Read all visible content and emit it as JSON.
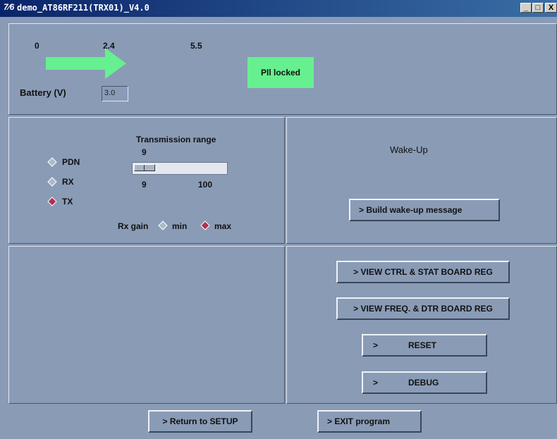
{
  "window": {
    "icon_text": "7⁄6",
    "title": "demo_AT86RF211(TRX01)_V4.0",
    "minimize": "_",
    "maximize": "□",
    "close": "X"
  },
  "battery": {
    "scale_labels": [
      "0",
      "2.4",
      "5.5"
    ],
    "label": "Battery (V)",
    "value": "3.0",
    "indicator_color": "#66f08f"
  },
  "pll_status": "Pll locked",
  "mode": {
    "options": [
      "PDN",
      "RX",
      "TX"
    ],
    "selected": "TX"
  },
  "transmission_range": {
    "title": "Transmission range",
    "current": "9",
    "min": "9",
    "max": "100",
    "level": 0
  },
  "rx_gain": {
    "label": "Rx gain",
    "options": [
      "min",
      "max"
    ],
    "selected": "max"
  },
  "wakeup": {
    "title": "Wake-Up",
    "build_button": ">   Build wake-up message"
  },
  "board_buttons": {
    "view_ctrl": "> VIEW CTRL & STAT BOARD REG",
    "view_freq": "> VIEW FREQ. & DTR BOARD REG",
    "reset_arrow": ">",
    "reset": "RESET",
    "debug_arrow": ">",
    "debug": "DEBUG"
  },
  "footer": {
    "return": "> Return to SETUP",
    "exit": ">   EXIT program"
  },
  "colors": {
    "selected_radio": "#b03050",
    "unselected_radio": "#aeb9ca"
  }
}
